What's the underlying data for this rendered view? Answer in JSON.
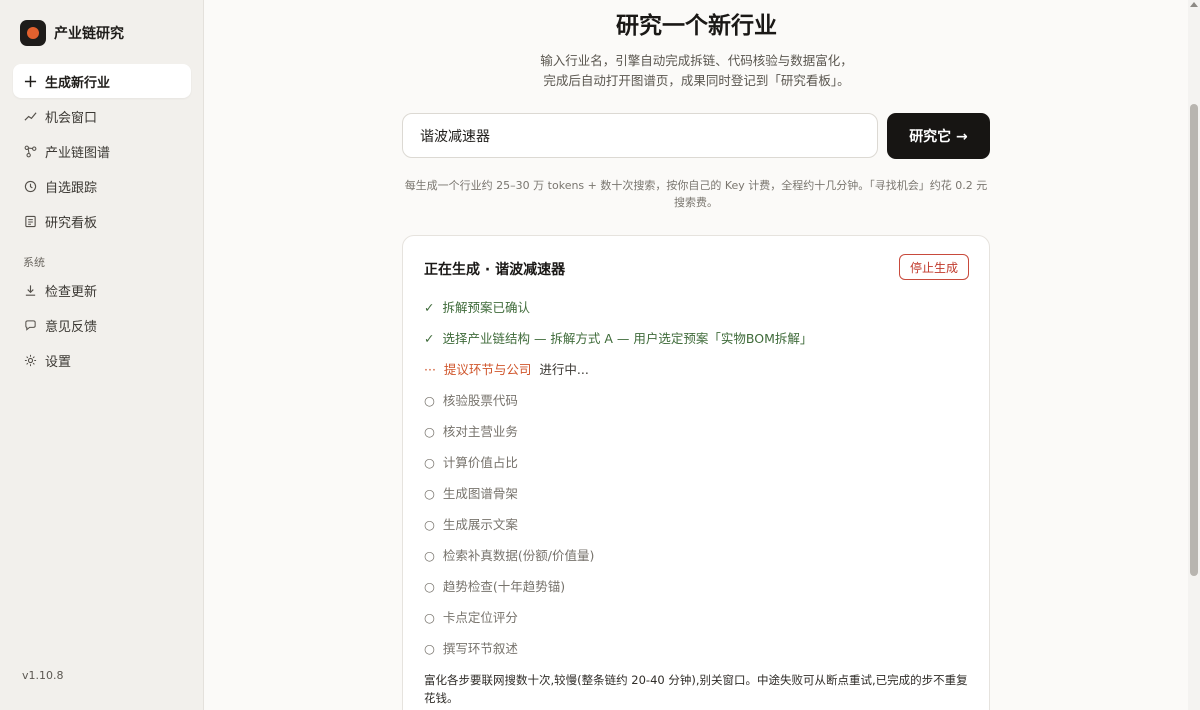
{
  "sidebar": {
    "brand": "产业链研究",
    "items": [
      {
        "label": "生成新行业",
        "icon": "plus-icon"
      },
      {
        "label": "机会窗口",
        "icon": "trend-line-icon"
      },
      {
        "label": "产业链图谱",
        "icon": "graph-nodes-icon"
      },
      {
        "label": "自选跟踪",
        "icon": "clock-icon"
      },
      {
        "label": "研究看板",
        "icon": "board-icon"
      }
    ],
    "section_label": "系统",
    "system_items": [
      {
        "label": "检查更新",
        "icon": "download-icon"
      },
      {
        "label": "意见反馈",
        "icon": "chat-bubble-icon"
      },
      {
        "label": "设置",
        "icon": "gear-icon"
      }
    ],
    "version": "v1.10.8"
  },
  "main": {
    "title": "研究一个新行业",
    "subtitle_line1": "输入行业名，引擎自动完成拆链、代码核验与数据富化，",
    "subtitle_line2": "完成后自动打开图谱页，成果同时登记到「研究看板」。",
    "input_value": "谐波减速器",
    "submit_label": "研究它 →",
    "hint": "每生成一个行业约 25–30 万 tokens + 数十次搜索，按你自己的 Key 计费，全程约十几分钟。「寻找机会」约花 0.2 元搜索费。"
  },
  "progress": {
    "title": "正在生成 · 谐波减速器",
    "stop_label": "停止生成",
    "steps": [
      {
        "mark": "✓",
        "name": "拆解预案已确认",
        "status": "",
        "state": "done"
      },
      {
        "mark": "✓",
        "name": "选择产业链结构 — 拆解方式 A — 用户选定预案「实物BOM拆解」",
        "status": "",
        "state": "done"
      },
      {
        "mark": "···",
        "name": "提议环节与公司",
        "status": "进行中...",
        "state": "running"
      },
      {
        "mark": "○",
        "name": "核验股票代码",
        "status": "",
        "state": "pending"
      },
      {
        "mark": "○",
        "name": "核对主营业务",
        "status": "",
        "state": "pending"
      },
      {
        "mark": "○",
        "name": "计算价值占比",
        "status": "",
        "state": "pending"
      },
      {
        "mark": "○",
        "name": "生成图谱骨架",
        "status": "",
        "state": "pending"
      },
      {
        "mark": "○",
        "name": "生成展示文案",
        "status": "",
        "state": "pending"
      },
      {
        "mark": "○",
        "name": "检索补真数据(份额/价值量)",
        "status": "",
        "state": "pending"
      },
      {
        "mark": "○",
        "name": "趋势检查(十年趋势锚)",
        "status": "",
        "state": "pending"
      },
      {
        "mark": "○",
        "name": "卡点定位评分",
        "status": "",
        "state": "pending"
      },
      {
        "mark": "○",
        "name": "撰写环节叙述",
        "status": "",
        "state": "pending"
      }
    ],
    "note": "富化各步要联网搜数十次,较慢(整条链约 20-40 分钟),别关窗口。中途失败可从断点重试,已完成的步不重复花钱。"
  },
  "colors": {
    "accent": "#e2612e",
    "done": "#3f6b3a",
    "running": "#d0562c",
    "stop": "#c0392b"
  }
}
